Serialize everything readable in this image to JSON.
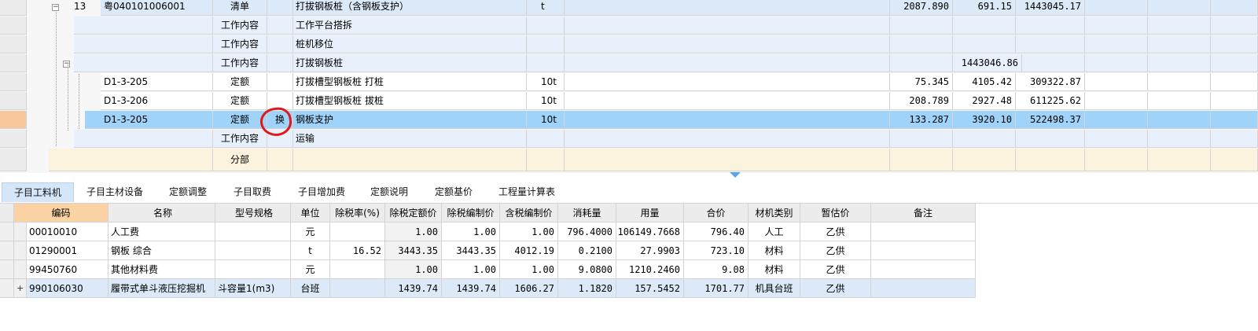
{
  "top_grid": {
    "rows": [
      {
        "seq": "13",
        "code": "粤040101006001",
        "type": "清单",
        "flag": "",
        "name": "打拔钢板桩（含钢板支护）",
        "unit": "t",
        "qty": "2087.890",
        "price": "691.15",
        "total": "1443045.17"
      },
      {
        "seq": "",
        "code": "",
        "type": "工作内容",
        "flag": "",
        "name": "工作平台搭拆",
        "unit": "",
        "qty": "",
        "price": "",
        "total": ""
      },
      {
        "seq": "",
        "code": "",
        "type": "工作内容",
        "flag": "",
        "name": "桩机移位",
        "unit": "",
        "qty": "",
        "price": "",
        "total": ""
      },
      {
        "seq": "",
        "code": "",
        "type": "工作内容",
        "flag": "",
        "name": "打拔钢板桩",
        "unit": "",
        "qty": "",
        "price": "",
        "total": "1443046.86"
      },
      {
        "seq": "",
        "code": "D1-3-205",
        "type": "定额",
        "flag": "",
        "name": "打拔槽型钢板桩 打桩",
        "unit": "10t",
        "qty": "75.345",
        "price": "4105.42",
        "total": "309322.87"
      },
      {
        "seq": "",
        "code": "D1-3-206",
        "type": "定额",
        "flag": "",
        "name": "打拔槽型钢板桩 拔桩",
        "unit": "10t",
        "qty": "208.789",
        "price": "2927.48",
        "total": "611225.62"
      },
      {
        "seq": "",
        "code": "D1-3-205",
        "type": "定额",
        "flag": "换",
        "name": "钢板支护",
        "unit": "10t",
        "qty": "133.287",
        "price": "3920.10",
        "total": "522498.37"
      },
      {
        "seq": "",
        "code": "",
        "type": "工作内容",
        "flag": "",
        "name": "运输",
        "unit": "",
        "qty": "",
        "price": "",
        "total": ""
      },
      {
        "seq": "",
        "code": "",
        "type": "分部",
        "flag": "",
        "name": "",
        "unit": "",
        "qty": "",
        "price": "",
        "total": ""
      }
    ]
  },
  "tabs": [
    {
      "label": "子目工料机",
      "active": true
    },
    {
      "label": "子目主材设备"
    },
    {
      "label": "定额调整"
    },
    {
      "label": "子目取费"
    },
    {
      "label": "子目增加费"
    },
    {
      "label": "定额说明"
    },
    {
      "label": "定额基价"
    },
    {
      "label": "工程量计算表"
    }
  ],
  "bottom_grid": {
    "headers": {
      "code": "编码",
      "name": "名称",
      "spec": "型号规格",
      "unit": "单位",
      "tax_rate": "除税率(%)",
      "price_ex": "除税定额价",
      "price_ex_comp": "除税编制价",
      "price_in_comp": "含税编制价",
      "consumption": "消耗量",
      "amount": "用量",
      "sum": "合价",
      "category": "材机类别",
      "estimate": "暂估价",
      "note": "备注"
    },
    "rows": [
      {
        "code": "00010010",
        "name": "人工费",
        "spec": "",
        "unit": "元",
        "tax_rate": "",
        "price_ex": "1.00",
        "price_ex_comp": "1.00",
        "price_in_comp": "1.00",
        "consumption": "796.4000",
        "amount": "106149.7668",
        "sum": "796.40",
        "category": "人工",
        "estimate": "乙供",
        "note": ""
      },
      {
        "code": "01290001",
        "name": "钢板 综合",
        "spec": "",
        "unit": "t",
        "tax_rate": "16.52",
        "price_ex": "3443.35",
        "price_ex_comp": "3443.35",
        "price_in_comp": "4012.19",
        "consumption": "0.2100",
        "amount": "27.9903",
        "sum": "723.10",
        "category": "材料",
        "estimate": "乙供",
        "note": ""
      },
      {
        "code": "99450760",
        "name": "其他材料费",
        "spec": "",
        "unit": "元",
        "tax_rate": "",
        "price_ex": "1.00",
        "price_ex_comp": "1.00",
        "price_in_comp": "1.00",
        "consumption": "9.0800",
        "amount": "1210.2460",
        "sum": "9.08",
        "category": "材料",
        "estimate": "乙供",
        "note": ""
      },
      {
        "code": "990106030",
        "name": "履带式单斗液压挖掘机",
        "spec": "斗容量1(m3)",
        "unit": "台班",
        "tax_rate": "",
        "price_ex": "1439.74",
        "price_ex_comp": "1439.74",
        "price_in_comp": "1606.27",
        "consumption": "1.1820",
        "amount": "157.5452",
        "sum": "1701.77",
        "category": "机具台班",
        "estimate": "乙供",
        "note": ""
      }
    ]
  },
  "colors": {
    "selected_row": "#9fd3fa",
    "tab_active": "#d5e6f8",
    "code_header": "#fbd2a3",
    "annotation": "#e21818"
  }
}
